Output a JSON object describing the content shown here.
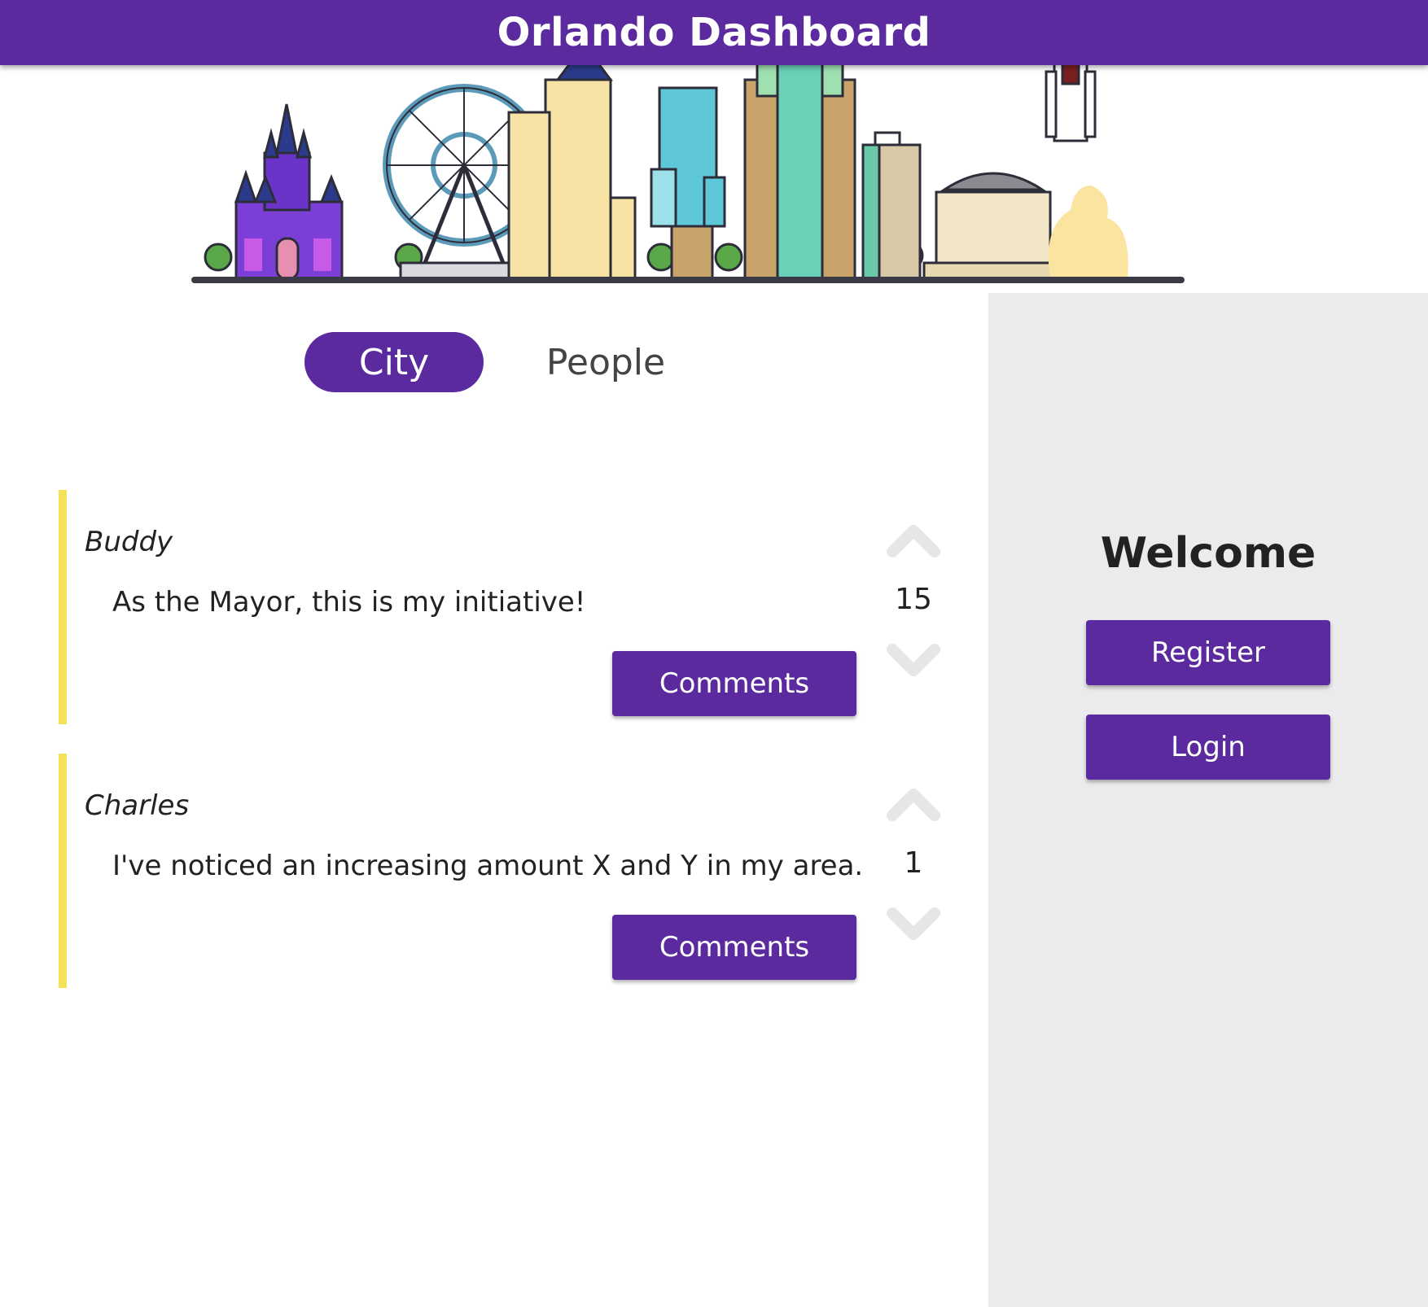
{
  "header": {
    "title": "Orlando Dashboard"
  },
  "tabs": [
    {
      "label": "City",
      "active": true
    },
    {
      "label": "People",
      "active": false
    }
  ],
  "posts": [
    {
      "author": "Buddy",
      "body": "As the Mayor, this is my initiative!",
      "votes": "15",
      "comments_label": "Comments"
    },
    {
      "author": "Charles",
      "body": "I've noticed an increasing amount X and Y in my area.",
      "votes": "1",
      "comments_label": "Comments"
    }
  ],
  "sidebar": {
    "welcome": "Welcome",
    "register_label": "Register",
    "login_label": "Login"
  },
  "colors": {
    "primary": "#5a2a9e",
    "accent_border": "#f5e05a",
    "sidebar_bg": "#ebebed",
    "vote_arrow": "#e6e6e8"
  },
  "icons": {
    "upvote": "chevron-up-icon",
    "downvote": "chevron-down-icon",
    "banner": "orlando-skyline-illustration"
  }
}
